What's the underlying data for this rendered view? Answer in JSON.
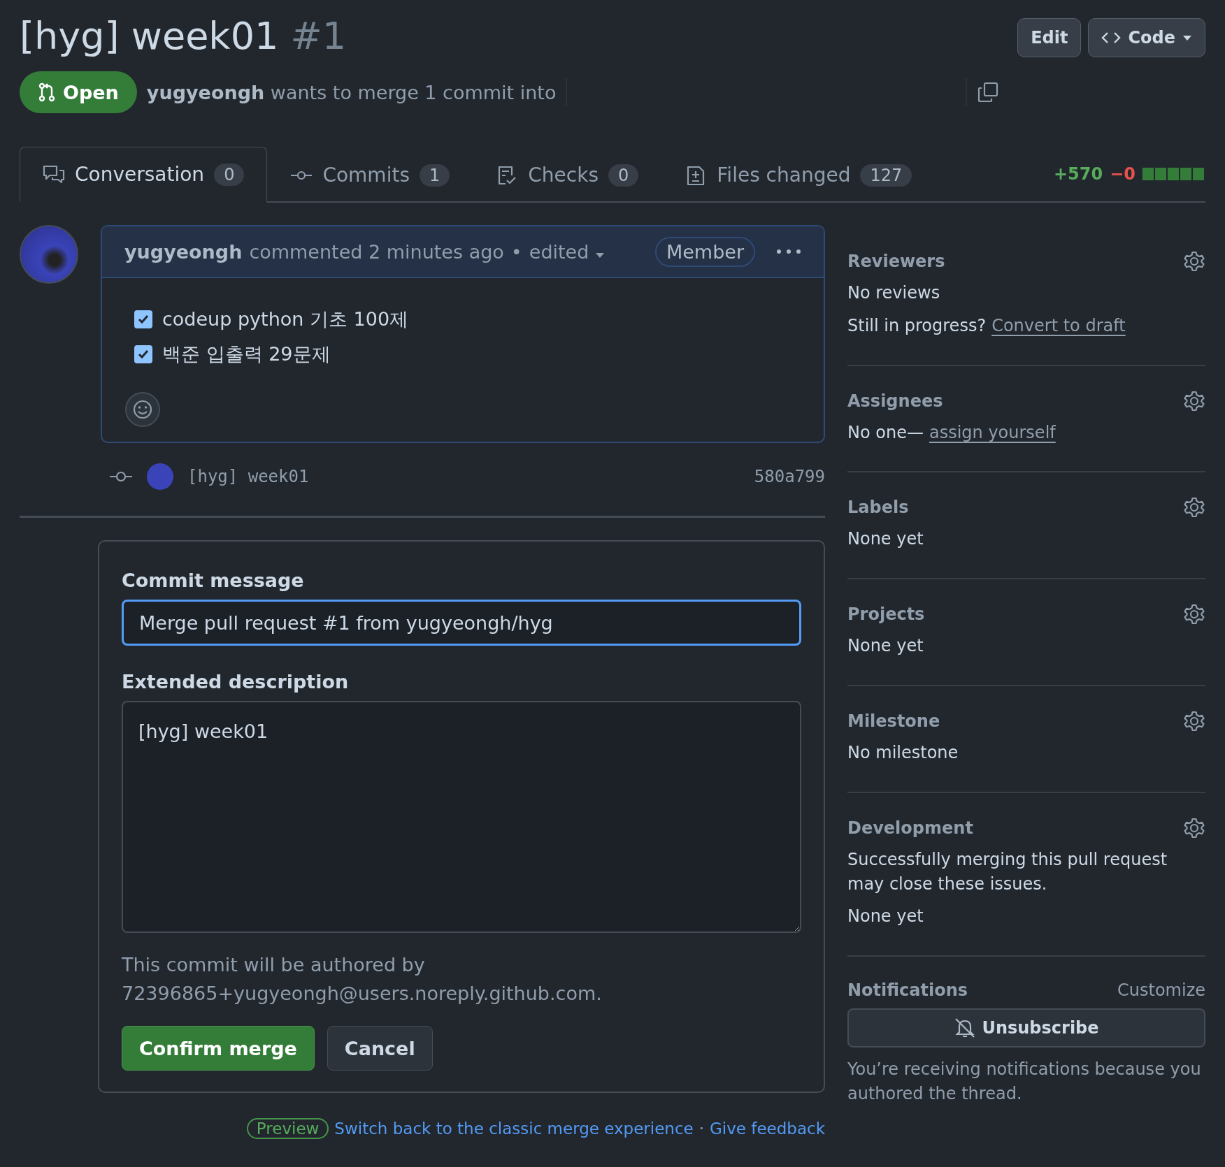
{
  "header": {
    "title": "[hyg] week01",
    "number": "#1",
    "buttons": [
      {
        "kind": "edit",
        "label": "Edit"
      },
      {
        "kind": "code",
        "label": "Code"
      }
    ],
    "state": "Open",
    "author": "yugyeongh",
    "summary": "wants to merge 1 commit into"
  },
  "tabs": [
    {
      "kind": "conversation",
      "label": "Conversation",
      "count": "0",
      "selected": true
    },
    {
      "kind": "commits",
      "label": "Commits",
      "count": "1",
      "selected": false
    },
    {
      "kind": "checks",
      "label": "Checks",
      "count": "0",
      "selected": false
    },
    {
      "kind": "files",
      "label": "Files changed",
      "count": "127",
      "selected": false
    }
  ],
  "diffstat": {
    "added": "+570",
    "removed": "−0"
  },
  "comment": {
    "author": "yugyeongh",
    "meta": "commented 2 minutes ago",
    "separator": "•",
    "edited": "edited",
    "role": "Member",
    "tasks": [
      {
        "label": "codeup python 기초 100제",
        "checked": true
      },
      {
        "label": "백준 입출력 29문제",
        "checked": true
      }
    ]
  },
  "commit": {
    "message": "[hyg] week01",
    "sha": "580a799"
  },
  "merge_form": {
    "commit_message_label": "Commit message",
    "commit_message": "Merge pull request #1 from yugyeongh/hyg",
    "description_label": "Extended description",
    "description": "[hyg] week01",
    "author_note": "This commit will be authored by",
    "author_email": "72396865+yugyeongh@users.noreply.github.com.",
    "buttons": [
      {
        "kind": "primary",
        "label": "Confirm merge"
      },
      {
        "kind": "secondary",
        "label": "Cancel"
      }
    ]
  },
  "footer": {
    "badge": "Preview",
    "link": "Switch back to the classic merge experience",
    "separator": "·",
    "feedback": "Give feedback"
  },
  "sidebar": {
    "sections": [
      {
        "heading": "Reviewers",
        "lines": [
          {
            "text": "No reviews"
          },
          {
            "text": "Still in progress?",
            "link": "Convert to draft"
          }
        ]
      },
      {
        "heading": "Assignees",
        "lines": [
          {
            "text": "No one—",
            "link": "assign yourself"
          }
        ]
      },
      {
        "heading": "Labels",
        "lines": [
          {
            "text": "None yet"
          }
        ]
      },
      {
        "heading": "Projects",
        "lines": [
          {
            "text": "None yet"
          }
        ]
      },
      {
        "heading": "Milestone",
        "lines": [
          {
            "text": "No milestone"
          }
        ]
      },
      {
        "heading": "Development",
        "lines": [
          {
            "text": "Successfully merging this pull request may close these issues."
          },
          {
            "text": "None yet"
          }
        ]
      }
    ],
    "notifications": {
      "heading": "Notifications",
      "action": "Customize",
      "button": "Unsubscribe",
      "note": "You’re receiving notifications because you authored the thread."
    }
  }
}
